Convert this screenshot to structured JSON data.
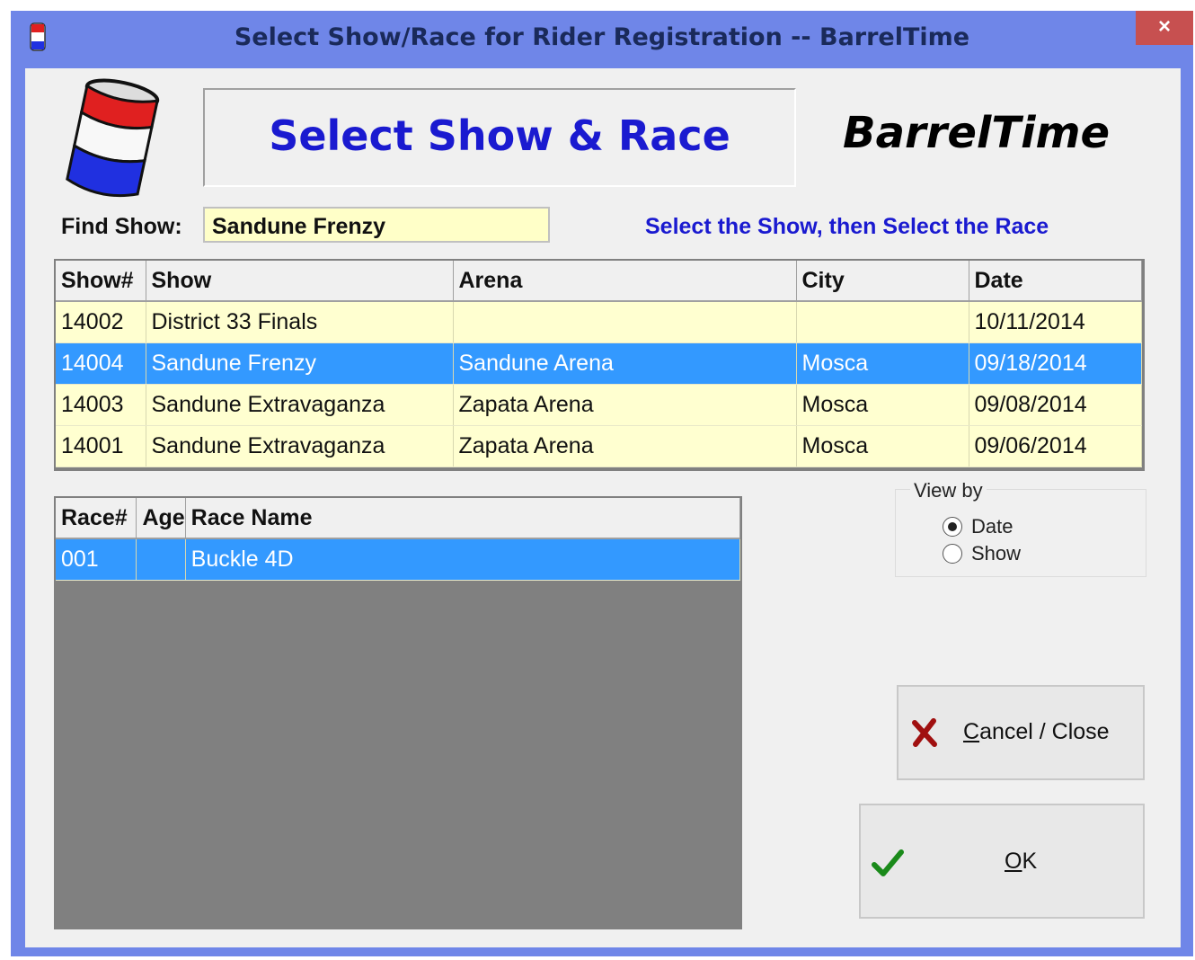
{
  "window": {
    "title": "Select Show/Race for Rider Registration -- BarrelTime",
    "close_label": "×"
  },
  "header": {
    "title": "Select Show & Race",
    "brand": "BarrelTime"
  },
  "find": {
    "label": "Find Show:",
    "value": "Sandune Frenzy"
  },
  "hint": "Select the  Show, then  Select the Race",
  "shows": {
    "columns": [
      "Show#",
      "Show",
      "Arena",
      "City",
      "Date"
    ],
    "rows": [
      {
        "num": "14002",
        "show": "District 33 Finals",
        "arena": "",
        "city": "",
        "date": "10/11/2014",
        "selected": false
      },
      {
        "num": "14004",
        "show": "Sandune Frenzy",
        "arena": "Sandune Arena",
        "city": "Mosca",
        "date": "09/18/2014",
        "selected": true
      },
      {
        "num": "14003",
        "show": "Sandune Extravaganza",
        "arena": "Zapata Arena",
        "city": "Mosca",
        "date": "09/08/2014",
        "selected": false
      },
      {
        "num": "14001",
        "show": "Sandune Extravaganza",
        "arena": "Zapata Arena",
        "city": "Mosca",
        "date": "09/06/2014",
        "selected": false
      }
    ]
  },
  "races": {
    "columns": [
      "Race#",
      "Age",
      "Race Name"
    ],
    "rows": [
      {
        "num": "001",
        "age": "",
        "name": "Buckle 4D",
        "selected": true
      }
    ]
  },
  "view_by": {
    "label": "View by",
    "options": [
      {
        "label": "Date",
        "checked": true
      },
      {
        "label": "Show",
        "checked": false
      }
    ]
  },
  "buttons": {
    "cancel": {
      "mnemonic": "C",
      "rest": "ancel / Close",
      "icon": "x-icon"
    },
    "ok": {
      "mnemonic": "O",
      "rest": "K",
      "icon": "checkmark-icon"
    }
  },
  "colors": {
    "selected_row": "#3399ff",
    "row_bg": "#ffffd0",
    "title_blue": "#1a1ad0",
    "window_frame": "#6f86e8",
    "close_red": "#c75050"
  }
}
